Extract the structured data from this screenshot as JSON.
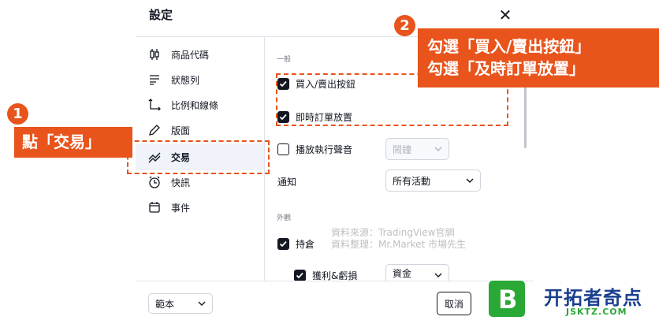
{
  "dialog": {
    "title": "設定",
    "sidebar": [
      {
        "label": "商品代碼",
        "icon": "candlestick-icon"
      },
      {
        "label": "狀態列",
        "icon": "status-lines-icon"
      },
      {
        "label": "比例和線條",
        "icon": "scale-lines-icon"
      },
      {
        "label": "版面",
        "icon": "pencil-icon"
      },
      {
        "label": "交易",
        "icon": "trading-icon"
      },
      {
        "label": "快訊",
        "icon": "alarm-clock-icon"
      },
      {
        "label": "事件",
        "icon": "calendar-icon"
      }
    ],
    "section_general": "一般",
    "buy_sell_label": "買入/賣出按鈕",
    "instant_order_label": "即時訂單放置",
    "play_sound_label": "播放執行聲音",
    "sound_value": "鬧鐘",
    "notify_label": "通知",
    "notify_value": "所有活動",
    "section_appearance": "外觀",
    "positions_label": "持倉",
    "pnl_label": "獲利&虧損",
    "pnl_value": "資金",
    "template_label": "範本",
    "cancel_label": "取消"
  },
  "annotations": {
    "badge1": "1",
    "callout1": "點「交易」",
    "badge2": "2",
    "callout2_line1": "勾選「買入/賣出按鈕」",
    "callout2_line2": "勾選「及時訂單放置」"
  },
  "watermark": {
    "line1": "資料來源：TradingView官網",
    "line2": "資料整理：Mr.Market 市場先生"
  },
  "logo": {
    "letter": "B",
    "text_cn": "开拓者奇点",
    "text_en": "JSKTZ.COM"
  },
  "colors": {
    "accent": "#e8541c",
    "logo_green": "#2aa836",
    "logo_blue": "#1a3f8f"
  }
}
